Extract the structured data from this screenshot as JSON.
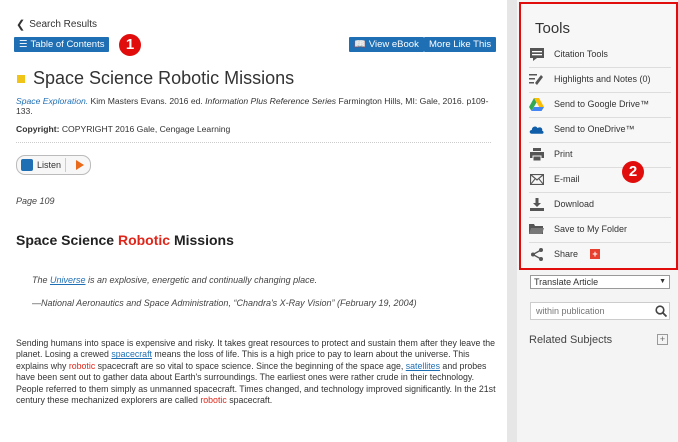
{
  "nav": {
    "back_label": "Search Results",
    "toc_label": "Table of Contents",
    "view_ebook_label": "View eBook",
    "more_like_this_label": "More Like This"
  },
  "callouts": {
    "one": "1",
    "two": "2"
  },
  "document": {
    "title": "Space Science Robotic Missions",
    "citation_source": "Space Exploration.",
    "citation_author": " Kim Masters Evans. 2016 ed. ",
    "citation_series": "Information Plus Reference Series",
    "citation_rest": " Farmington Hills, MI: Gale, 2016. p109-133.",
    "copyright_label": "Copyright:",
    "copyright_text": " COPYRIGHT 2016 Gale, Cengage Learning",
    "listen_label": "Listen",
    "page_label": "Page 109",
    "heading_part1": "Space Science ",
    "heading_red": "Robotic",
    "heading_part2": " Missions",
    "quote1_pre": "The ",
    "quote1_link": "Universe",
    "quote1_post": " is an explosive, energetic and continually changing place.",
    "quote2": "—National Aeronautics and Space Administration, “Chandra's X-Ray Vision” (February 19, 2004)",
    "para": {
      "s1": "Sending humans into space is expensive and risky. It takes great resources to protect and sustain them after they leave the planet. Losing a crewed ",
      "link1": "spacecraft",
      "s2": " means the loss of life. This is a high price to pay to learn about the universe. This explains why ",
      "red1": "robotic",
      "s3": " spacecraft are so vital to space science. Since the beginning of the space age, ",
      "link2": "satellites",
      "s4": " and probes have been sent out to gather data about Earth's surroundings. The earliest ones were rather crude in their technology. People referred to them simply as unmanned spacecraft. Times changed, and technology improved significantly. In the 21st century these mechanized explorers are called ",
      "red2": "robotic",
      "s5": " spacecraft."
    }
  },
  "tools": {
    "title": "Tools",
    "items": [
      {
        "label": "Citation Tools",
        "icon": "citation-icon"
      },
      {
        "label": "Highlights and Notes (0)",
        "icon": "highlight-icon"
      },
      {
        "label": "Send to Google Drive™",
        "icon": "google-drive-icon"
      },
      {
        "label": "Send to OneDrive™",
        "icon": "onedrive-icon"
      },
      {
        "label": "Print",
        "icon": "printer-icon"
      },
      {
        "label": "E-mail",
        "icon": "email-icon"
      },
      {
        "label": "Download",
        "icon": "download-icon"
      },
      {
        "label": "Save to My Folder",
        "icon": "folder-icon"
      },
      {
        "label": "Share",
        "icon": "share-icon"
      }
    ]
  },
  "sidebar": {
    "translate_label": "Translate Article",
    "within_placeholder": "within publication",
    "related_label": "Related Subjects"
  },
  "colors": {
    "accent_blue": "#1f6fb5",
    "callout_red": "#e10d0d",
    "highlight_red": "#e0261a"
  }
}
